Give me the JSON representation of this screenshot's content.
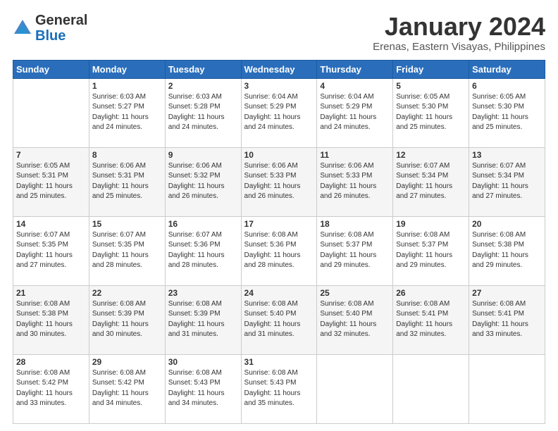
{
  "header": {
    "logo_general": "General",
    "logo_blue": "Blue",
    "month_year": "January 2024",
    "location": "Erenas, Eastern Visayas, Philippines"
  },
  "days_of_week": [
    "Sunday",
    "Monday",
    "Tuesday",
    "Wednesday",
    "Thursday",
    "Friday",
    "Saturday"
  ],
  "weeks": [
    [
      {
        "day": "",
        "sunrise": "",
        "sunset": "",
        "daylight": ""
      },
      {
        "day": "1",
        "sunrise": "Sunrise: 6:03 AM",
        "sunset": "Sunset: 5:27 PM",
        "daylight": "Daylight: 11 hours and 24 minutes."
      },
      {
        "day": "2",
        "sunrise": "Sunrise: 6:03 AM",
        "sunset": "Sunset: 5:28 PM",
        "daylight": "Daylight: 11 hours and 24 minutes."
      },
      {
        "day": "3",
        "sunrise": "Sunrise: 6:04 AM",
        "sunset": "Sunset: 5:29 PM",
        "daylight": "Daylight: 11 hours and 24 minutes."
      },
      {
        "day": "4",
        "sunrise": "Sunrise: 6:04 AM",
        "sunset": "Sunset: 5:29 PM",
        "daylight": "Daylight: 11 hours and 24 minutes."
      },
      {
        "day": "5",
        "sunrise": "Sunrise: 6:05 AM",
        "sunset": "Sunset: 5:30 PM",
        "daylight": "Daylight: 11 hours and 25 minutes."
      },
      {
        "day": "6",
        "sunrise": "Sunrise: 6:05 AM",
        "sunset": "Sunset: 5:30 PM",
        "daylight": "Daylight: 11 hours and 25 minutes."
      }
    ],
    [
      {
        "day": "7",
        "sunrise": "Sunrise: 6:05 AM",
        "sunset": "Sunset: 5:31 PM",
        "daylight": "Daylight: 11 hours and 25 minutes."
      },
      {
        "day": "8",
        "sunrise": "Sunrise: 6:06 AM",
        "sunset": "Sunset: 5:31 PM",
        "daylight": "Daylight: 11 hours and 25 minutes."
      },
      {
        "day": "9",
        "sunrise": "Sunrise: 6:06 AM",
        "sunset": "Sunset: 5:32 PM",
        "daylight": "Daylight: 11 hours and 26 minutes."
      },
      {
        "day": "10",
        "sunrise": "Sunrise: 6:06 AM",
        "sunset": "Sunset: 5:33 PM",
        "daylight": "Daylight: 11 hours and 26 minutes."
      },
      {
        "day": "11",
        "sunrise": "Sunrise: 6:06 AM",
        "sunset": "Sunset: 5:33 PM",
        "daylight": "Daylight: 11 hours and 26 minutes."
      },
      {
        "day": "12",
        "sunrise": "Sunrise: 6:07 AM",
        "sunset": "Sunset: 5:34 PM",
        "daylight": "Daylight: 11 hours and 27 minutes."
      },
      {
        "day": "13",
        "sunrise": "Sunrise: 6:07 AM",
        "sunset": "Sunset: 5:34 PM",
        "daylight": "Daylight: 11 hours and 27 minutes."
      }
    ],
    [
      {
        "day": "14",
        "sunrise": "Sunrise: 6:07 AM",
        "sunset": "Sunset: 5:35 PM",
        "daylight": "Daylight: 11 hours and 27 minutes."
      },
      {
        "day": "15",
        "sunrise": "Sunrise: 6:07 AM",
        "sunset": "Sunset: 5:35 PM",
        "daylight": "Daylight: 11 hours and 28 minutes."
      },
      {
        "day": "16",
        "sunrise": "Sunrise: 6:07 AM",
        "sunset": "Sunset: 5:36 PM",
        "daylight": "Daylight: 11 hours and 28 minutes."
      },
      {
        "day": "17",
        "sunrise": "Sunrise: 6:08 AM",
        "sunset": "Sunset: 5:36 PM",
        "daylight": "Daylight: 11 hours and 28 minutes."
      },
      {
        "day": "18",
        "sunrise": "Sunrise: 6:08 AM",
        "sunset": "Sunset: 5:37 PM",
        "daylight": "Daylight: 11 hours and 29 minutes."
      },
      {
        "day": "19",
        "sunrise": "Sunrise: 6:08 AM",
        "sunset": "Sunset: 5:37 PM",
        "daylight": "Daylight: 11 hours and 29 minutes."
      },
      {
        "day": "20",
        "sunrise": "Sunrise: 6:08 AM",
        "sunset": "Sunset: 5:38 PM",
        "daylight": "Daylight: 11 hours and 29 minutes."
      }
    ],
    [
      {
        "day": "21",
        "sunrise": "Sunrise: 6:08 AM",
        "sunset": "Sunset: 5:38 PM",
        "daylight": "Daylight: 11 hours and 30 minutes."
      },
      {
        "day": "22",
        "sunrise": "Sunrise: 6:08 AM",
        "sunset": "Sunset: 5:39 PM",
        "daylight": "Daylight: 11 hours and 30 minutes."
      },
      {
        "day": "23",
        "sunrise": "Sunrise: 6:08 AM",
        "sunset": "Sunset: 5:39 PM",
        "daylight": "Daylight: 11 hours and 31 minutes."
      },
      {
        "day": "24",
        "sunrise": "Sunrise: 6:08 AM",
        "sunset": "Sunset: 5:40 PM",
        "daylight": "Daylight: 11 hours and 31 minutes."
      },
      {
        "day": "25",
        "sunrise": "Sunrise: 6:08 AM",
        "sunset": "Sunset: 5:40 PM",
        "daylight": "Daylight: 11 hours and 32 minutes."
      },
      {
        "day": "26",
        "sunrise": "Sunrise: 6:08 AM",
        "sunset": "Sunset: 5:41 PM",
        "daylight": "Daylight: 11 hours and 32 minutes."
      },
      {
        "day": "27",
        "sunrise": "Sunrise: 6:08 AM",
        "sunset": "Sunset: 5:41 PM",
        "daylight": "Daylight: 11 hours and 33 minutes."
      }
    ],
    [
      {
        "day": "28",
        "sunrise": "Sunrise: 6:08 AM",
        "sunset": "Sunset: 5:42 PM",
        "daylight": "Daylight: 11 hours and 33 minutes."
      },
      {
        "day": "29",
        "sunrise": "Sunrise: 6:08 AM",
        "sunset": "Sunset: 5:42 PM",
        "daylight": "Daylight: 11 hours and 34 minutes."
      },
      {
        "day": "30",
        "sunrise": "Sunrise: 6:08 AM",
        "sunset": "Sunset: 5:43 PM",
        "daylight": "Daylight: 11 hours and 34 minutes."
      },
      {
        "day": "31",
        "sunrise": "Sunrise: 6:08 AM",
        "sunset": "Sunset: 5:43 PM",
        "daylight": "Daylight: 11 hours and 35 minutes."
      },
      {
        "day": "",
        "sunrise": "",
        "sunset": "",
        "daylight": ""
      },
      {
        "day": "",
        "sunrise": "",
        "sunset": "",
        "daylight": ""
      },
      {
        "day": "",
        "sunrise": "",
        "sunset": "",
        "daylight": ""
      }
    ]
  ]
}
